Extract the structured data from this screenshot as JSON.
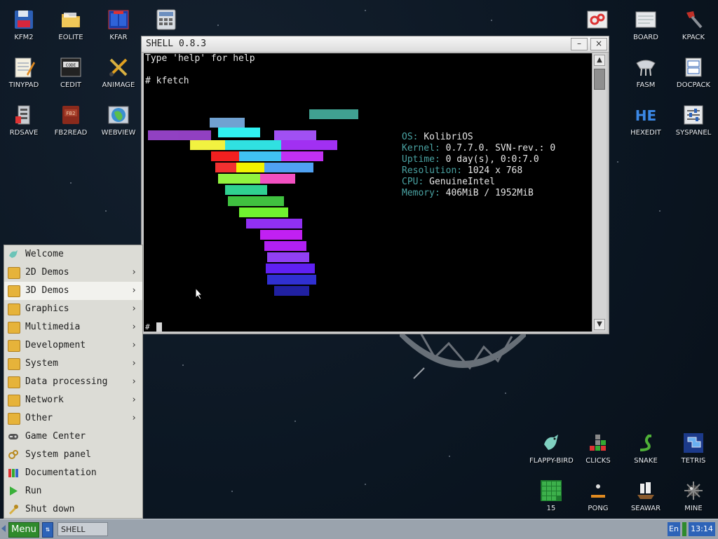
{
  "desktop": {
    "left_icons": [
      {
        "label": "KFM2",
        "icon": "floppy-icon"
      },
      {
        "label": "EOLITE",
        "icon": "folder-icon"
      },
      {
        "label": "KFAR",
        "icon": "kfar-icon"
      },
      {
        "label": "TINYPAD",
        "icon": "notepad-icon"
      },
      {
        "label": "CEDIT",
        "icon": "code-icon"
      },
      {
        "label": "ANIMAGE",
        "icon": "paint-icon"
      },
      {
        "label": "RDSAVE",
        "icon": "rdsave-icon"
      },
      {
        "label": "FB2READ",
        "icon": "book-icon"
      },
      {
        "label": "WEBVIEW",
        "icon": "globe-icon"
      }
    ],
    "calculator_icon": "calculator-icon",
    "right_icons": [
      {
        "label": "",
        "icon": "gears-icon"
      },
      {
        "label": "BOARD",
        "icon": "board-icon"
      },
      {
        "label": "KPACK",
        "icon": "hammer-icon"
      },
      {
        "label": "FASM",
        "icon": "fasm-icon"
      },
      {
        "label": "DOCPACK",
        "icon": "docpack-icon"
      },
      {
        "label": "HEXEDIT",
        "icon": "hex-icon"
      },
      {
        "label": "SYSPANEL",
        "icon": "sliders-icon"
      }
    ],
    "game_icons": [
      {
        "label": "FLAPPY-BIRD",
        "icon": "bird-icon"
      },
      {
        "label": "CLICKS",
        "icon": "blocks-icon"
      },
      {
        "label": "SNAKE",
        "icon": "snake-icon"
      },
      {
        "label": "TETRIS",
        "icon": "tetris-icon"
      },
      {
        "label": "15",
        "icon": "grid15-icon"
      },
      {
        "label": "PONG",
        "icon": "pong-icon"
      },
      {
        "label": "SEAWAR",
        "icon": "ship-icon"
      },
      {
        "label": "MINE",
        "icon": "mine-icon"
      }
    ]
  },
  "shell": {
    "title": "SHELL 0.8.3",
    "minimize": "–",
    "close": "×",
    "line1": "Type 'help' for help",
    "line2": "# kfetch",
    "prompt": "#",
    "info": [
      {
        "k": "OS",
        "v": "KolibriOS"
      },
      {
        "k": "Kernel",
        "v": "0.7.7.0. SVN-rev.: 0"
      },
      {
        "k": "Uptime",
        "v": "0 day(s), 0:0:7.0"
      },
      {
        "k": "Resolution",
        "v": "1024 x 768"
      },
      {
        "k": "CPU",
        "v": "GenuineIntel"
      },
      {
        "k": "Memory",
        "v": "406MiB / 1952MiB"
      }
    ]
  },
  "menu": {
    "items": [
      {
        "label": "Welcome",
        "icon": "bird-icon",
        "sub": false
      },
      {
        "label": "2D Demos",
        "icon": "folder-icon",
        "sub": true
      },
      {
        "label": "3D Demos",
        "icon": "folder-icon",
        "sub": true,
        "highlight": true
      },
      {
        "label": "Graphics",
        "icon": "folder-icon",
        "sub": true
      },
      {
        "label": "Multimedia",
        "icon": "folder-icon",
        "sub": true
      },
      {
        "label": "Development",
        "icon": "folder-icon",
        "sub": true
      },
      {
        "label": "System",
        "icon": "folder-icon",
        "sub": true
      },
      {
        "label": "Data processing",
        "icon": "folder-icon",
        "sub": true
      },
      {
        "label": "Network",
        "icon": "folder-icon",
        "sub": true
      },
      {
        "label": "Other",
        "icon": "folder-icon",
        "sub": true
      },
      {
        "label": "Game Center",
        "icon": "gamepad-icon",
        "sub": false
      },
      {
        "label": "System panel",
        "icon": "gears-icon",
        "sub": false
      },
      {
        "label": "Documentation",
        "icon": "books-icon",
        "sub": false
      },
      {
        "label": "Run",
        "icon": "play-icon",
        "sub": false
      },
      {
        "label": "Shut down",
        "icon": "power-icon",
        "sub": false
      }
    ],
    "arrow": "›"
  },
  "taskbar": {
    "menu_label": "Menu",
    "task": "SHELL",
    "lang": "En",
    "clock": "13:14"
  }
}
